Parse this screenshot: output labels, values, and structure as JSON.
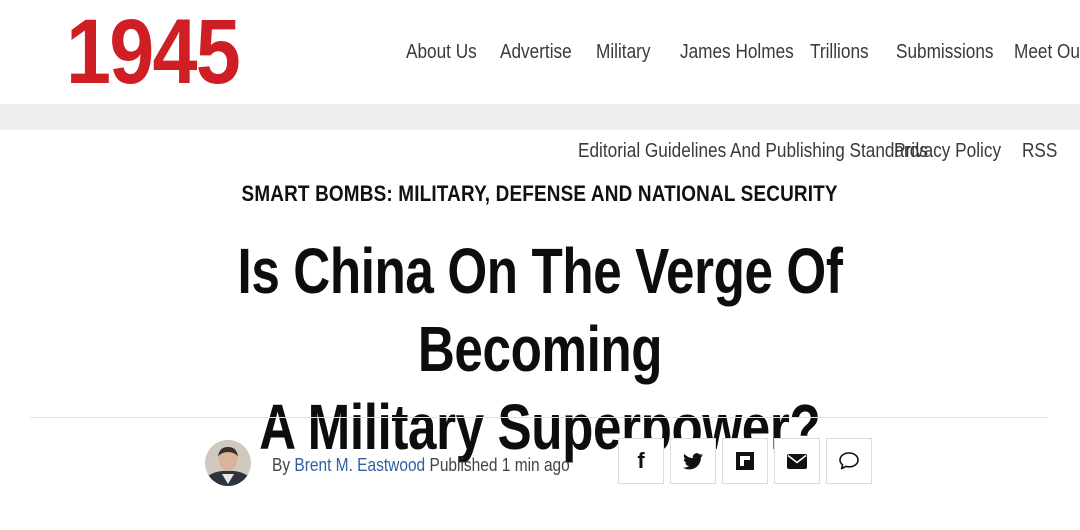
{
  "header": {
    "logo_text": "1945",
    "logo_color": "#cf1f25",
    "nav": [
      {
        "label": "About Us"
      },
      {
        "label": "Advertise"
      },
      {
        "label": "Military"
      },
      {
        "label": "James Holmes"
      },
      {
        "label": "Trillions"
      },
      {
        "label": "Submissions"
      },
      {
        "label": "Meet Our"
      }
    ]
  },
  "subnav": [
    {
      "label": "Editorial Guidelines And Publishing Standards"
    },
    {
      "label": "Privacy Policy"
    },
    {
      "label": "RSS"
    }
  ],
  "article": {
    "category": "SMART BOMBS: MILITARY, DEFENSE AND NATIONAL SECURITY",
    "headline_line1": "Is China On The Verge Of Becoming",
    "headline_line2": "A Military Superpower?",
    "byline_prefix": "By",
    "author": "Brent M. Eastwood",
    "published_label": "Published",
    "published_time": "1 min ago",
    "author_link_color": "#2e5fa3"
  },
  "share": [
    {
      "icon": "facebook-icon"
    },
    {
      "icon": "twitter-icon"
    },
    {
      "icon": "flipboard-icon"
    },
    {
      "icon": "email-icon"
    },
    {
      "icon": "comment-icon"
    }
  ]
}
